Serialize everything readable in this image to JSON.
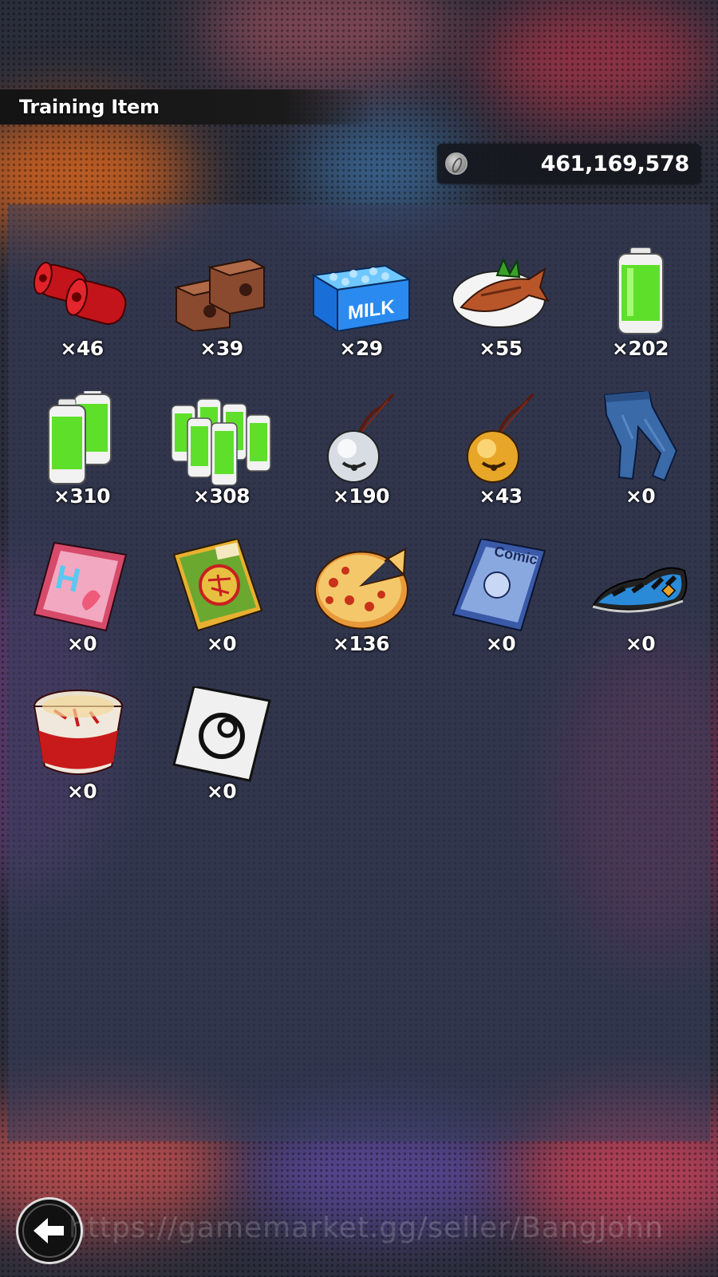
{
  "header": {
    "title": "Training Item"
  },
  "currency": {
    "icon": "silver-coin-icon",
    "amount": "461,169,578"
  },
  "items": [
    {
      "name": "red-weights",
      "count": "×46"
    },
    {
      "name": "brick-weights",
      "count": "×39"
    },
    {
      "name": "milk-carton",
      "count": "×29",
      "label": "MILK"
    },
    {
      "name": "grilled-fish",
      "count": "×55"
    },
    {
      "name": "battery-single",
      "count": "×202"
    },
    {
      "name": "battery-double",
      "count": "×310"
    },
    {
      "name": "battery-pack",
      "count": "×308"
    },
    {
      "name": "silver-bell",
      "count": "×190"
    },
    {
      "name": "gold-bell",
      "count": "×43"
    },
    {
      "name": "jeans",
      "count": "×0"
    },
    {
      "name": "h-magazine",
      "count": "×0"
    },
    {
      "name": "joke-book",
      "count": "×0"
    },
    {
      "name": "pizza",
      "count": "×136"
    },
    {
      "name": "comic-book",
      "count": "×0",
      "label": "Comic"
    },
    {
      "name": "blue-slipper",
      "count": "×0"
    },
    {
      "name": "cup-noodles",
      "count": "×0"
    },
    {
      "name": "capsule-card",
      "count": "×0"
    }
  ],
  "footer": {
    "back_icon": "back-arrow-icon",
    "watermark": "https://gamemarket.gg/seller/BangJohn"
  }
}
